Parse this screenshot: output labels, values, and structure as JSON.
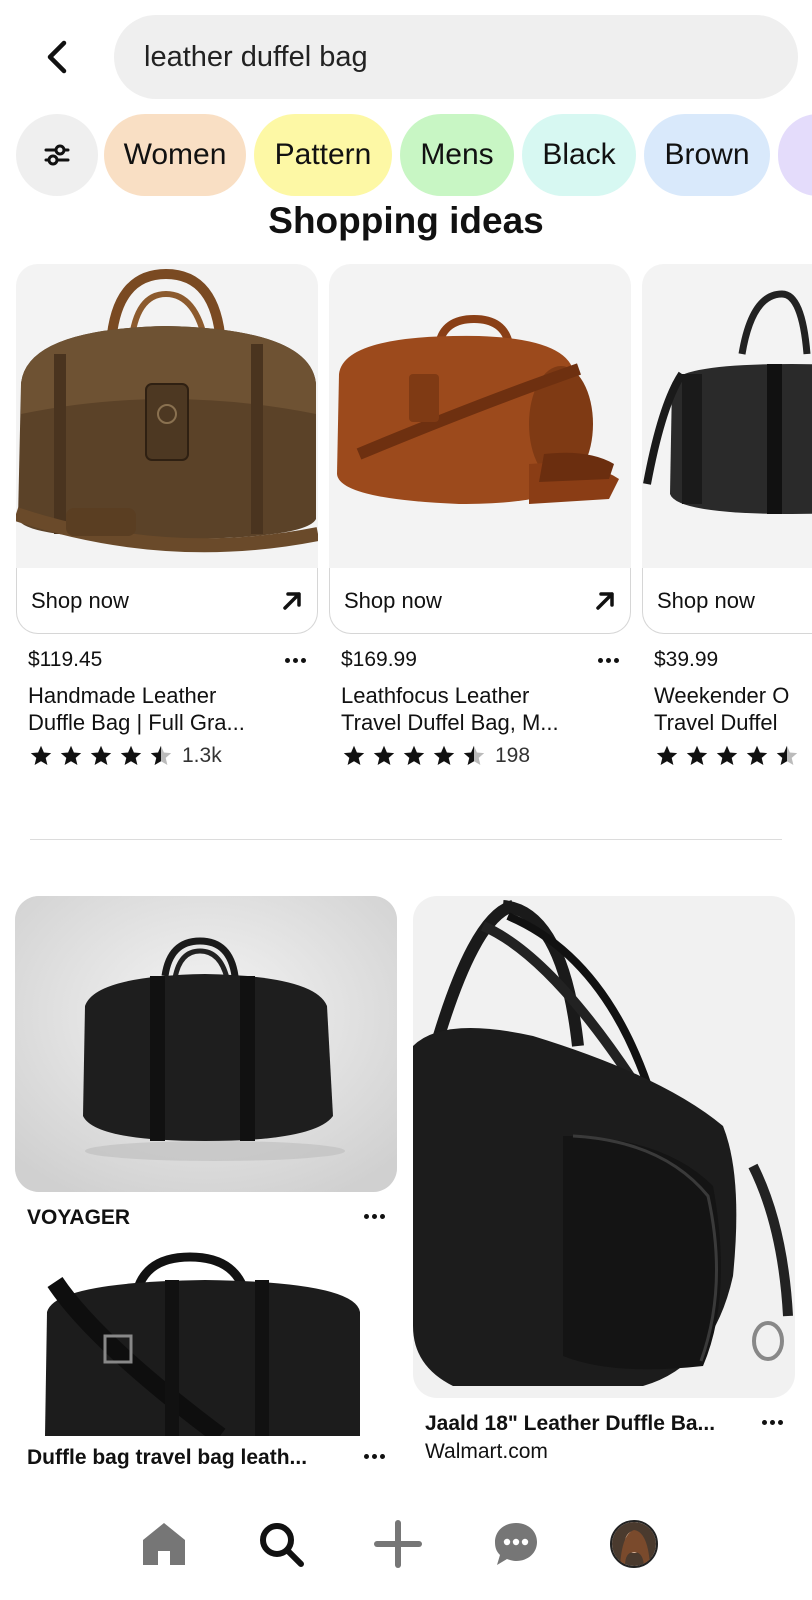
{
  "search": {
    "query": "leather duffel bag"
  },
  "chips": [
    {
      "label": "Women",
      "color": "#f9dfc4"
    },
    {
      "label": "Pattern",
      "color": "#fdf8a5"
    },
    {
      "label": "Mens",
      "color": "#c8f6c4"
    },
    {
      "label": "Black",
      "color": "#d7f8f2"
    },
    {
      "label": "Brown",
      "color": "#d9e9fb"
    }
  ],
  "section_title": "Shopping ideas",
  "shopping": [
    {
      "cta": "Shop now",
      "price": "$119.45",
      "title_line1": "Handmade Leather",
      "title_line2": "Duffle Bag | Full Gra...",
      "rating_count": "1.3k",
      "rating": 4.5
    },
    {
      "cta": "Shop now",
      "price": "$169.99",
      "title_line1": "Leathfocus Leather",
      "title_line2": "Travel Duffel Bag, M...",
      "rating_count": "198",
      "rating": 4.5
    },
    {
      "cta": "Shop now",
      "price": "$39.99",
      "title_line1": "Weekender O",
      "title_line2": "Travel Duffel",
      "rating": 4.5
    }
  ],
  "pins": {
    "voyager": {
      "title": "VOYAGER"
    },
    "jaald": {
      "title": "Jaald 18\" Leather Duffle Ba...",
      "source": "Walmart.com"
    },
    "duffle": {
      "title": "Duffle bag travel bag leath..."
    }
  },
  "nav": [
    "home-icon",
    "search-icon",
    "plus-icon",
    "chat-icon",
    "avatar"
  ]
}
